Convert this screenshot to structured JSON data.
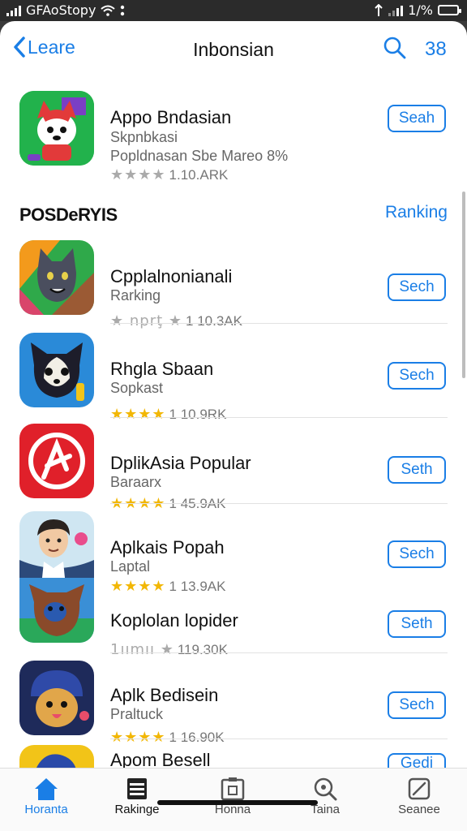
{
  "status": {
    "left_text": "GFAoStopy",
    "battery_text": "1/%"
  },
  "nav": {
    "back_label": "Leare",
    "title": "Inbonsian",
    "count": "38"
  },
  "featured": {
    "name": "Appo Bndasian",
    "subtitle": "Skpnbkasi",
    "subtitle2": "Popldnasan Sbe Mareo 8%",
    "rating": "1.10.ARK",
    "button": "Seah"
  },
  "section": {
    "title": "POSDeRYIS",
    "link": "Ranking"
  },
  "apps": [
    {
      "name": "Cpplalnonianali",
      "subtitle": "Rarking",
      "stars_text": "★ nprţ ★",
      "rating": "1 10.3AK",
      "button": "Sech"
    },
    {
      "name": "Rhgla Sbaan",
      "subtitle": "Sopkast",
      "stars_text": "★★★★",
      "rating": "1 10.9RK",
      "button": "Sech"
    },
    {
      "name": "DplikAsia Popular",
      "subtitle": "Baraarx",
      "stars_text": "★★★★",
      "rating": "1 45.9AK",
      "button": "Seth"
    },
    {
      "name": "Aplkais Popah",
      "subtitle": "Laptal",
      "stars_text": "★★★★",
      "rating": "1 13.9AK",
      "button": "Sech"
    },
    {
      "name": "Koplolan lopider",
      "subtitle": "",
      "stars_text": "1ıımıı ★",
      "rating": "119.30K",
      "button": "Seth"
    },
    {
      "name": "Aplk Bedisein",
      "subtitle": "Praltuck",
      "stars_text": "★★★★",
      "rating": "1 16.90K",
      "button": "Sech"
    },
    {
      "name": "Apom Besell",
      "subtitle": "",
      "stars_text": "",
      "rating": "",
      "button": "Gedi"
    }
  ],
  "tabs": [
    {
      "label": "Horanta",
      "icon": "home-icon"
    },
    {
      "label": "Rakinge",
      "icon": "ranking-icon"
    },
    {
      "label": "Honna",
      "icon": "tablet-icon"
    },
    {
      "label": "Taina",
      "icon": "search-icon"
    },
    {
      "label": "Seanee",
      "icon": "edit-icon"
    }
  ],
  "colors": {
    "accent": "#1a7ee6",
    "star": "#f2b705",
    "active_tab": "#1a7ee6"
  }
}
